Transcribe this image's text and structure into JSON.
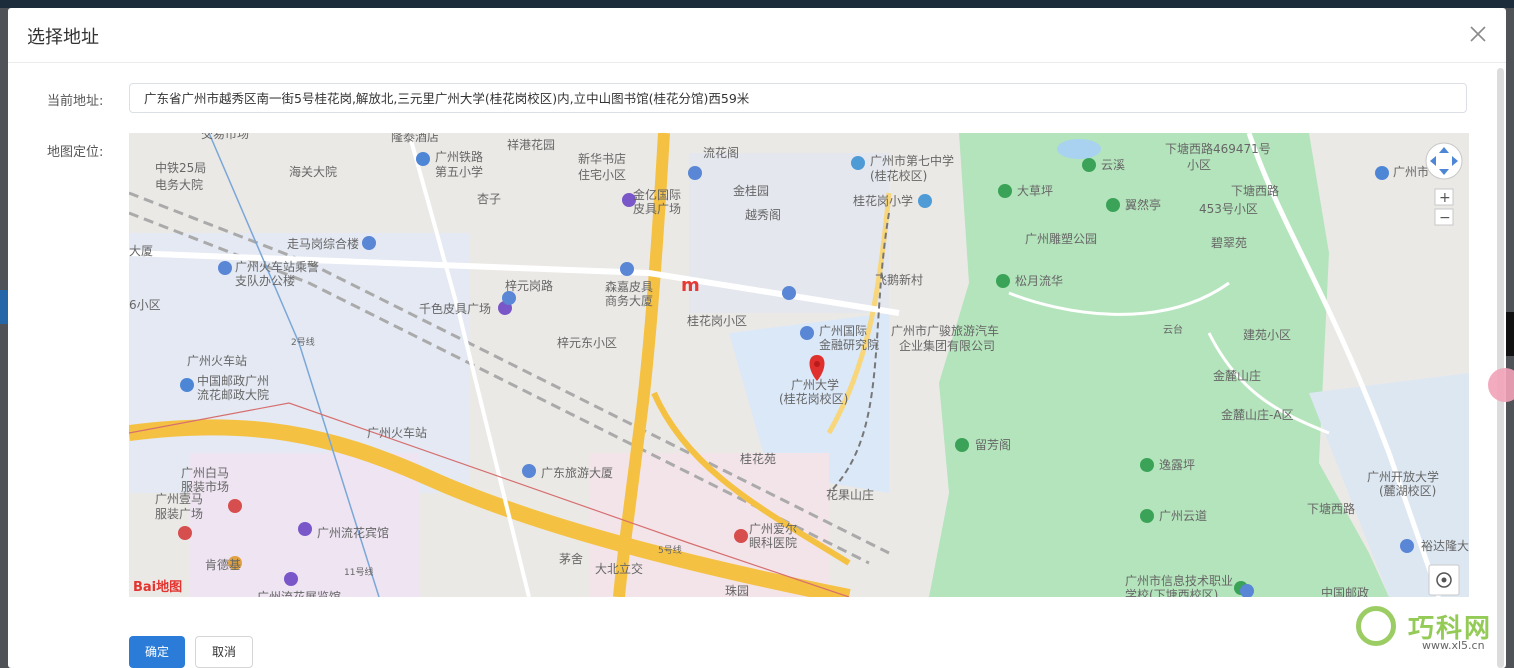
{
  "dialog": {
    "title": "选择地址",
    "close_icon": "close-icon"
  },
  "form": {
    "address_label": "当前地址:",
    "address_value": "广东省广州市越秀区南一街5号桂花岗,解放北,三元里广州大学(桂花岗校区)内,立中山图书馆(桂花分馆)西59米",
    "map_label": "地图定位:"
  },
  "map": {
    "pin_label_line1": "广州大学",
    "pin_label_line2": "(桂花岗校区)",
    "logo": "Bai地图",
    "controls": {
      "navigate_icon": "pan-arrows-icon",
      "zoom_in": "+",
      "zoom_out": "−",
      "locate_icon": "locate-icon"
    },
    "labels": [
      "交易市场",
      "隆泰酒店",
      "中铁25局",
      "电务大院",
      "海关大院",
      "广州铁路",
      "第五小学",
      "祥港花园",
      "新华书店",
      "住宅小区",
      "流花阁",
      "金桂园",
      "越秀阁",
      "广州市第七中学",
      "(桂花校区)",
      "桂花岗小学",
      "杏子",
      "金亿国际",
      "皮具广场",
      "走马岗综合楼",
      "广州火车站乘警",
      "支队办公楼",
      "梓元岗路",
      "森嘉皮具",
      "商务大厦",
      "千色皮具广场",
      "梓元东小区",
      "桂花岗小区",
      "广州国际",
      "金融研究院",
      "飞鹅新村",
      "广州市广骏旅游汽车",
      "企业集团有限公司",
      "2号线",
      "广州火车站",
      "中国邮政广州",
      "流花邮政大院",
      "广州火车站",
      "广东旅游大厦",
      "桂花苑",
      "花果山庄",
      "广州白马",
      "服装市场",
      "广州壹马",
      "服装广场",
      "广州流花宾馆",
      "广州爱尔",
      "眼科医院",
      "5号线",
      "肯德基",
      "11号线",
      "茅舍",
      "大北立交",
      "珠园",
      "广州流花展览馆",
      "云溪",
      "大草坪",
      "翼然亭",
      "广州雕塑公园",
      "松月流华",
      "下塘西路469471号",
      "小区",
      "下塘西路",
      "453号小区",
      "碧翠苑",
      "建苑小区",
      "金麓山庄",
      "金麓山庄-A区",
      "留芳阁",
      "逸露坪",
      "广州云道",
      "广州开放大学",
      "(麓湖校区)",
      "下塘西路",
      "裕达隆大厦",
      "广州市信息技术职业",
      "学校(下塘西校区)",
      "中国邮政",
      "广州市",
      "大厦",
      "6小区",
      "云台"
    ]
  },
  "footer": {
    "ok_label": "确定",
    "cancel_label": "取消"
  },
  "watermark": {
    "title": "巧科网",
    "url": "www.xl5.cn"
  },
  "colors": {
    "primary": "#2b7cd8",
    "map_pin": "#e0302d",
    "park_green": "#a9e2b1"
  }
}
